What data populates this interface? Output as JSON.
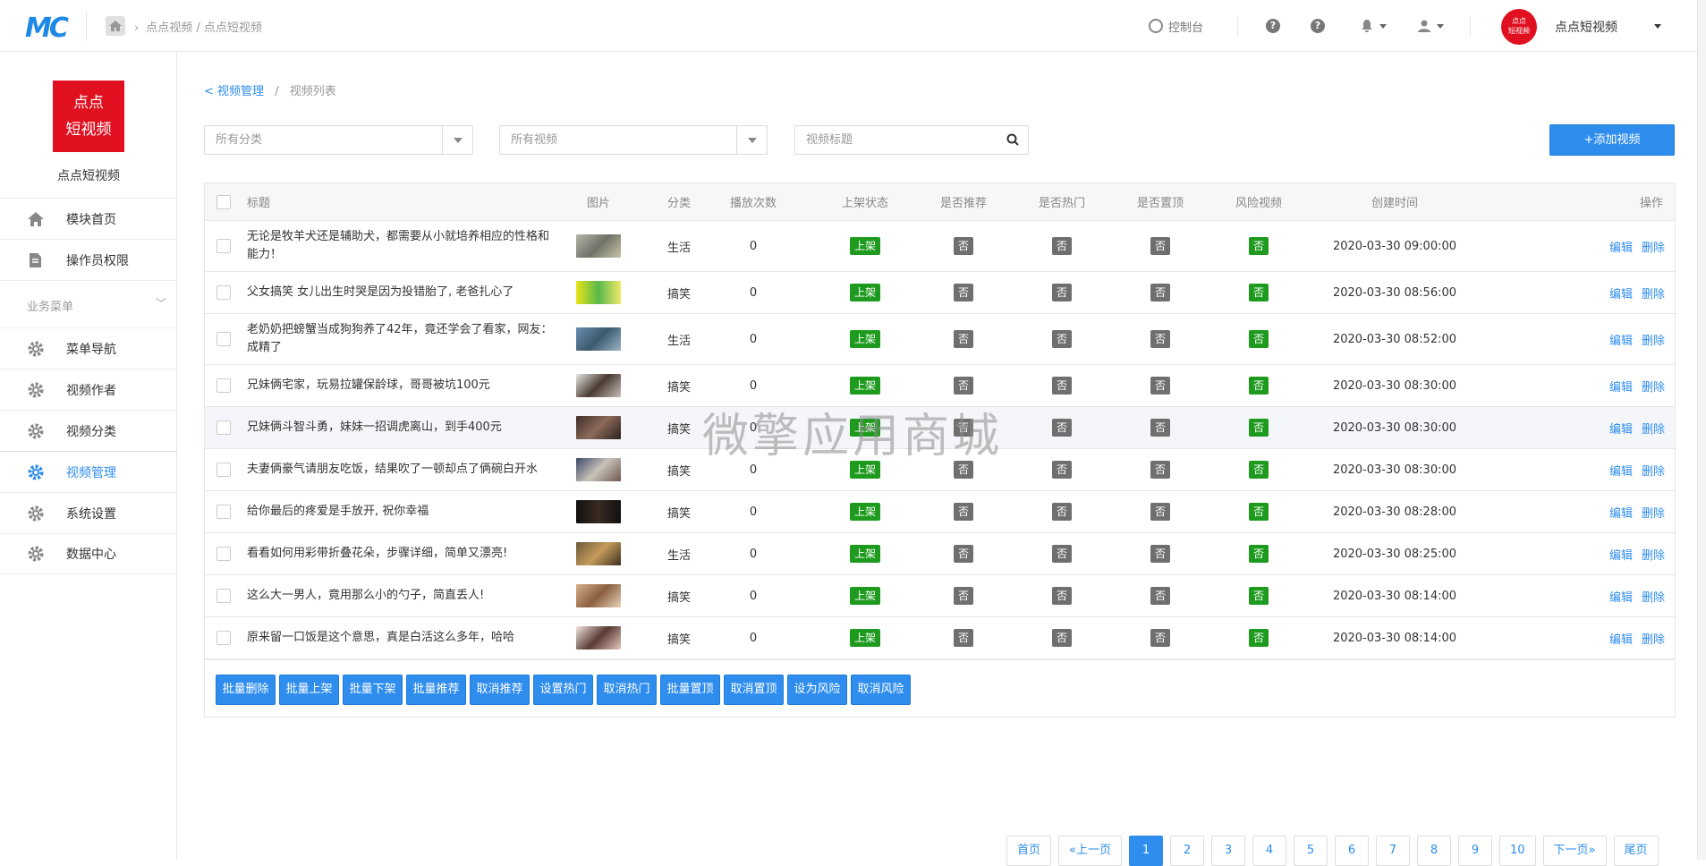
{
  "app": {
    "logo": "MC"
  },
  "topbar": {
    "breadcrumb": "点点视频 / 点点短视频",
    "console_label": "控制台",
    "help1": "?",
    "help2": "?",
    "avatar_text_l1": "点点",
    "avatar_text_l2": "短视频",
    "user_name": "点点短视频"
  },
  "sidebar": {
    "brand_l1": "点点",
    "brand_l2": "短视频",
    "brand_name": "点点短视频",
    "items_top": [
      {
        "label": "模块首页"
      },
      {
        "label": "操作员权限"
      }
    ],
    "section_title": "业务菜单",
    "items": [
      {
        "label": "菜单导航"
      },
      {
        "label": "视频作者"
      },
      {
        "label": "视频分类"
      },
      {
        "label": "视频管理"
      },
      {
        "label": "系统设置"
      },
      {
        "label": "数据中心"
      }
    ],
    "active_item": "视频管理"
  },
  "breadcrumb": {
    "parent": "视频管理",
    "current": "视频列表",
    "sep": "/",
    "back": "<"
  },
  "filters": {
    "category_placeholder": "所有分类",
    "video_placeholder": "所有视频",
    "search_placeholder": "视频标题"
  },
  "add_button": "+添加视频",
  "table": {
    "headers": [
      "标题",
      "图片",
      "分类",
      "播放次数",
      "上架状态",
      "是否推荐",
      "是否热门",
      "是否置顶",
      "风险视频",
      "创建时间",
      "操作"
    ],
    "rows": [
      {
        "title": "无论是牧羊犬还是辅助犬，都需要从小就培养相应的性格和能力！",
        "category": "生活",
        "plays": "0",
        "status": "上架",
        "rec": "否",
        "hot": "否",
        "top": "否",
        "risk": "否",
        "created": "2020-03-30 09:00:00"
      },
      {
        "title": "父女搞笑 女儿出生时哭是因为投错胎了, 老爸扎心了",
        "category": "搞笑",
        "plays": "0",
        "status": "上架",
        "rec": "否",
        "hot": "否",
        "top": "否",
        "risk": "否",
        "created": "2020-03-30 08:56:00"
      },
      {
        "title": "老奶奶把螃蟹当成狗狗养了42年，竟还学会了看家，网友：成精了",
        "category": "生活",
        "plays": "0",
        "status": "上架",
        "rec": "否",
        "hot": "否",
        "top": "否",
        "risk": "否",
        "created": "2020-03-30 08:52:00"
      },
      {
        "title": "兄妹俩宅家，玩易拉罐保龄球，哥哥被坑100元",
        "category": "搞笑",
        "plays": "0",
        "status": "上架",
        "rec": "否",
        "hot": "否",
        "top": "否",
        "risk": "否",
        "created": "2020-03-30 08:30:00"
      },
      {
        "title": "兄妹俩斗智斗勇，妹妹一招调虎离山，到手400元",
        "category": "搞笑",
        "plays": "0",
        "status": "上架",
        "rec": "否",
        "hot": "否",
        "top": "否",
        "risk": "否",
        "created": "2020-03-30 08:30:00"
      },
      {
        "title": "夫妻俩豪气请朋友吃饭，结果吹了一顿却点了俩碗白开水",
        "category": "搞笑",
        "plays": "0",
        "status": "上架",
        "rec": "否",
        "hot": "否",
        "top": "否",
        "risk": "否",
        "created": "2020-03-30 08:30:00"
      },
      {
        "title": "给你最后的疼爱是手放开, 祝你幸福",
        "category": "搞笑",
        "plays": "0",
        "status": "上架",
        "rec": "否",
        "hot": "否",
        "top": "否",
        "risk": "否",
        "created": "2020-03-30 08:28:00"
      },
      {
        "title": "看看如何用彩带折叠花朵，步骤详细，简单又漂亮!",
        "category": "生活",
        "plays": "0",
        "status": "上架",
        "rec": "否",
        "hot": "否",
        "top": "否",
        "risk": "否",
        "created": "2020-03-30 08:25:00"
      },
      {
        "title": "这么大一男人，竟用那么小的勺子，简直丢人!",
        "category": "搞笑",
        "plays": "0",
        "status": "上架",
        "rec": "否",
        "hot": "否",
        "top": "否",
        "risk": "否",
        "created": "2020-03-30 08:14:00"
      },
      {
        "title": "原来留一口饭是这个意思，真是白活这么多年，哈哈",
        "category": "搞笑",
        "plays": "0",
        "status": "上架",
        "rec": "否",
        "hot": "否",
        "top": "否",
        "risk": "否",
        "created": "2020-03-30 08:14:00"
      }
    ],
    "edit_label": "编辑",
    "delete_label": "删除"
  },
  "bulk_actions": [
    "批量删除",
    "批量上架",
    "批量下架",
    "批量推荐",
    "取消推荐",
    "设置热门",
    "取消热门",
    "批量置顶",
    "取消置顶",
    "设为风险",
    "取消风险"
  ],
  "pagination": [
    "首页",
    "«上一页",
    "1",
    "2",
    "3",
    "4",
    "5",
    "6",
    "7",
    "8",
    "9",
    "10",
    "下一页»",
    "尾页"
  ],
  "current_page": "1",
  "watermark": "微擎应用商城",
  "colors": {
    "accent": "#2e8ded",
    "brand_red": "#e01020",
    "status_green": "#1e9b1e",
    "badge_gray": "#6f6f6f"
  }
}
